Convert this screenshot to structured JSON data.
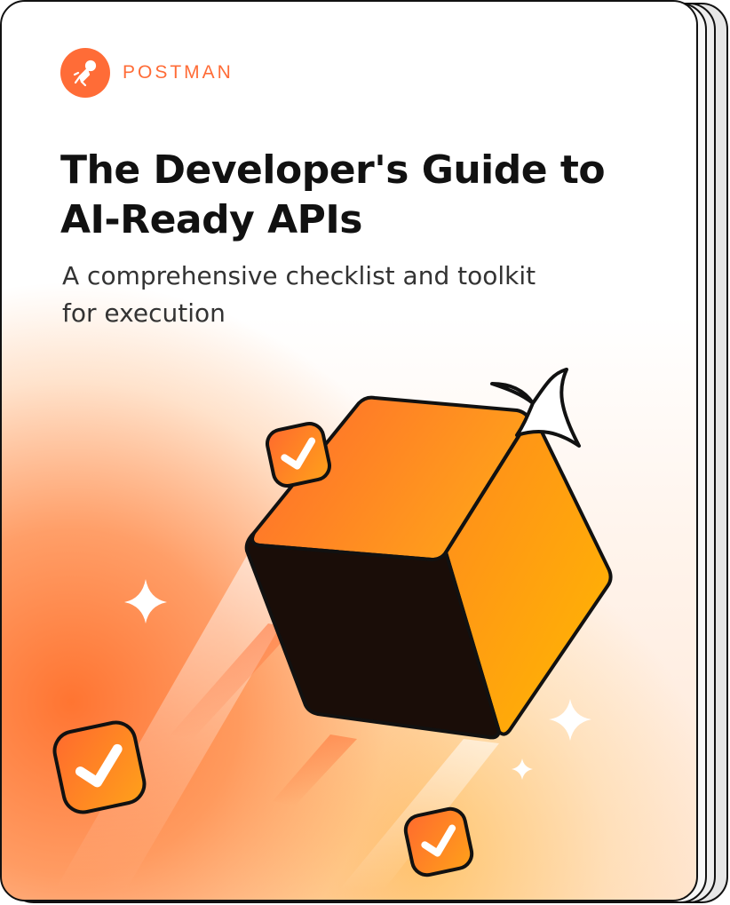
{
  "brand": {
    "name": "POSTMAN",
    "logo_icon": "postman-rocket-icon",
    "accent": "#ff6c37"
  },
  "cover": {
    "title": "The Developer's Guide to AI-Ready APIs",
    "subtitle": "A comprehensive checklist and toolkit for execution"
  },
  "illustration": {
    "main_icon": "cube-icon",
    "badge_icon": "checkmark-icon",
    "sparkle_icon": "sparkle-icon",
    "colors": {
      "cube_light": "#ff6c37",
      "cube_right": "#ffb300",
      "cube_dark": "#1a0d08",
      "badge": "#ff7a2a"
    }
  }
}
